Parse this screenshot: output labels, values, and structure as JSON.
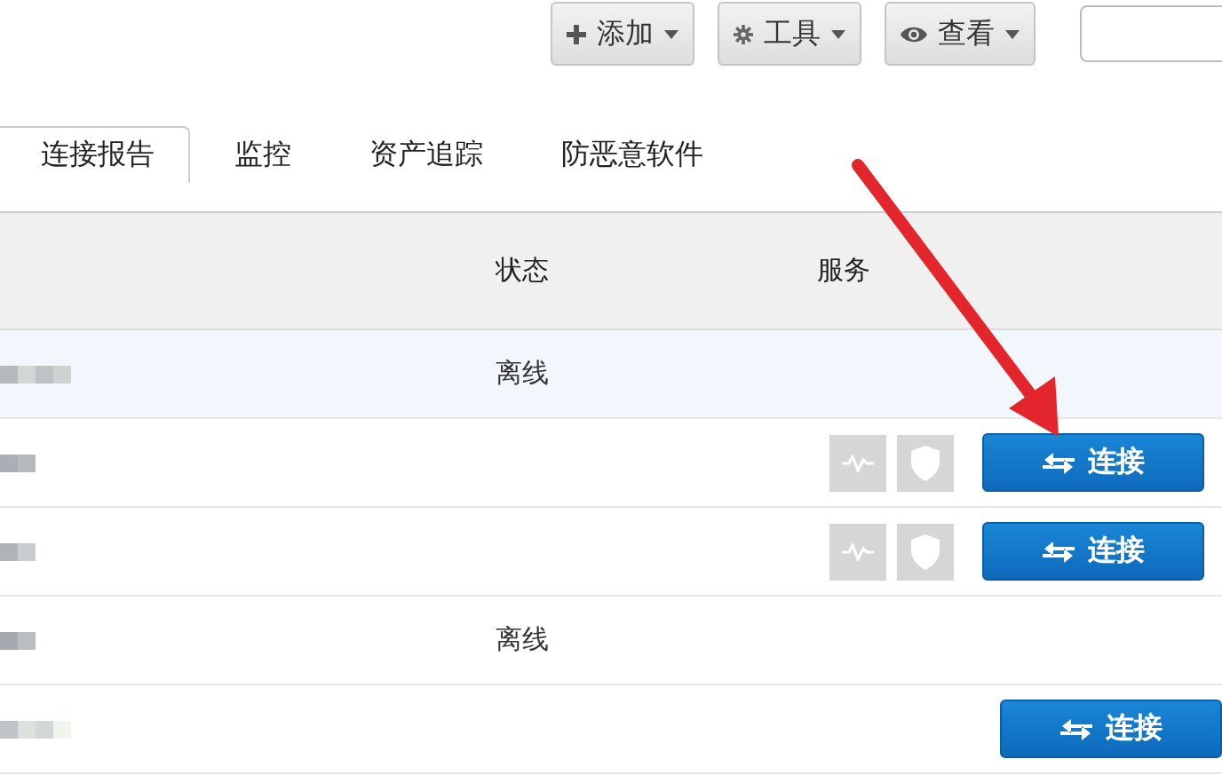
{
  "toolbar": [
    {
      "label": "添加"
    },
    {
      "label": "工具"
    },
    {
      "label": "查看"
    }
  ],
  "tabs": [
    {
      "label": "连接报告",
      "selected": true
    },
    {
      "label": "监控",
      "selected": false
    },
    {
      "label": "资产追踪",
      "selected": false
    },
    {
      "label": "防恶意软件",
      "selected": false
    }
  ],
  "table": {
    "columns": [
      "状态",
      "服务"
    ],
    "rows": [
      {
        "selected": true,
        "status": "离线",
        "services": false,
        "connect": null
      },
      {
        "selected": false,
        "services": true,
        "connect": "连接"
      },
      {
        "selected": false,
        "services": true,
        "connect": "连接"
      },
      {
        "selected": false,
        "status": "离线",
        "services": false,
        "connect": null
      },
      {
        "selected": false,
        "services": false,
        "connect": "连接"
      }
    ]
  }
}
